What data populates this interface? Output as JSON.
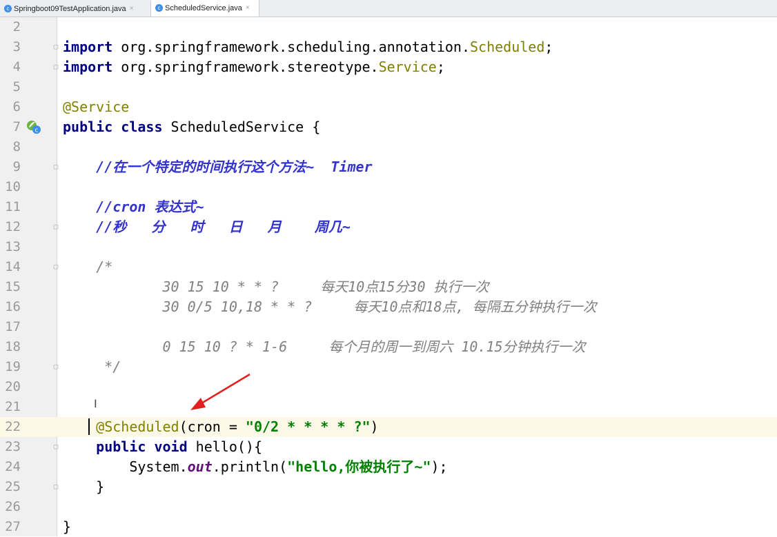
{
  "tabs": [
    {
      "label": "Springboot09TestApplication.java",
      "active": false
    },
    {
      "label": "ScheduledService.java",
      "active": true
    }
  ],
  "tab_close_glyph": "×",
  "colors": {
    "keyword": "#000080",
    "annotation": "#808000",
    "string": "#008000",
    "comment": "#808080",
    "doc_comment": "#3333cc",
    "arrow": "#e02020"
  },
  "lines": [
    {
      "n": "2",
      "text": ""
    },
    {
      "n": "3",
      "kw": "import",
      "pkg": " org.springframework.scheduling.annotation.",
      "cls": "Scheduled",
      "end": ";"
    },
    {
      "n": "4",
      "kw": "import",
      "pkg": " org.springframework.stereotype.",
      "cls": "Service",
      "end": ";"
    },
    {
      "n": "5",
      "text": ""
    },
    {
      "n": "6",
      "ann": "@Service"
    },
    {
      "n": "7",
      "kw1": "public",
      "kw2": "class",
      "rest": " ScheduledService {"
    },
    {
      "n": "8",
      "text": ""
    },
    {
      "n": "9",
      "comment": "    //在一个特定的时间执行这个方法~  Timer"
    },
    {
      "n": "10",
      "text": ""
    },
    {
      "n": "11",
      "comment": "    //cron 表达式~"
    },
    {
      "n": "12",
      "comment": "    //秒   分   时   日   月    周几~"
    },
    {
      "n": "13",
      "text": ""
    },
    {
      "n": "14",
      "block": "    /*"
    },
    {
      "n": "15",
      "block": "            30 15 10 * * ?     每天10点15分30 执行一次"
    },
    {
      "n": "16",
      "block": "            30 0/5 10,18 * * ?     每天10点和18点, 每隔五分钟执行一次"
    },
    {
      "n": "17",
      "text": ""
    },
    {
      "n": "18",
      "block": "            0 15 10 ? * 1-6     每个月的周一到周六 10.15分钟执行一次"
    },
    {
      "n": "19",
      "block": "     */"
    },
    {
      "n": "20",
      "text": ""
    },
    {
      "n": "21",
      "text": ""
    },
    {
      "n": "22",
      "ann": "@Scheduled",
      "mid": "(cron = ",
      "str": "\"0/2 * * * * ?\"",
      "end": ")"
    },
    {
      "n": "23",
      "kw1": "public",
      "kw2": "void",
      "rest": " hello(){"
    },
    {
      "n": "24",
      "pre": "        System.",
      "fld": "out",
      "mid": ".println(",
      "str": "\"hello,你被执行了~\"",
      "end": ");"
    },
    {
      "n": "25",
      "text": "    }"
    },
    {
      "n": "26",
      "text": ""
    },
    {
      "n": "27",
      "text": "}"
    }
  ]
}
